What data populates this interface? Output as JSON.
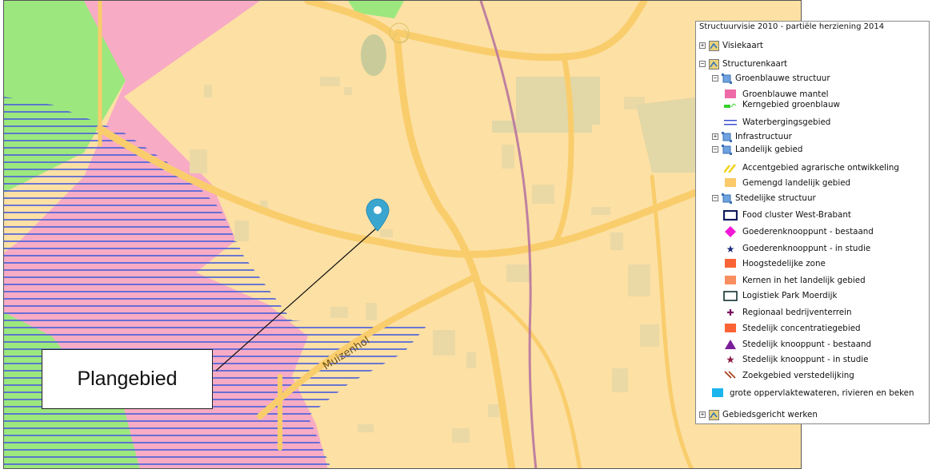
{
  "map": {
    "street_label": "Muizenhol",
    "plangebied_label": "Plangebied",
    "colors": {
      "background": "#fde0a4",
      "groenblauwe_mantel": "#f6a6c8",
      "kerngebied_groenblauw": "#9ce87e",
      "waterberging": "#4f63d8",
      "road": "#f9cd6c",
      "building": "#ebd9a5",
      "rail": "#b46fa0"
    }
  },
  "legend": {
    "title": "Structuurvisie 2010 - partiële herziening 2014",
    "items": [
      {
        "label": "Visiekaart",
        "level": 0,
        "toggle": "+",
        "icon": "layer-group-icon"
      },
      {
        "label": "Structurenkaart",
        "level": 0,
        "toggle": "−",
        "icon": "layer-group-icon"
      },
      {
        "label": "Groenblauwe structuur",
        "level": 1,
        "toggle": "−",
        "icon": "sublayer-icon"
      },
      {
        "label": "Groenblauwe mantel",
        "level": 2,
        "symbol": "pink-rect"
      },
      {
        "label": "Kerngebied groenblauw",
        "level": 2,
        "symbol": "green-line"
      },
      {
        "label": "Waterbergingsgebied",
        "level": 2,
        "symbol": "blue-double-line"
      },
      {
        "label": "Infrastructuur",
        "level": 1,
        "toggle": "+",
        "icon": "sublayer-icon"
      },
      {
        "label": "Landelijk gebied",
        "level": 1,
        "toggle": "−",
        "icon": "sublayer-icon"
      },
      {
        "label": "Accentgebied agrarische ontwikkeling",
        "level": 2,
        "symbol": "yellow-hatch"
      },
      {
        "label": "Gemengd landelijk gebied",
        "level": 2,
        "symbol": "orange-rect"
      },
      {
        "label": "Stedelijke structuur",
        "level": 1,
        "toggle": "−",
        "icon": "sublayer-icon"
      },
      {
        "label": "Food cluster West-Brabant",
        "level": 2,
        "symbol": "navy-outline-rect"
      },
      {
        "label": "Goederenknooppunt - bestaand",
        "level": 2,
        "symbol": "magenta-diamond"
      },
      {
        "label": "Goederenknooppunt - in studie",
        "level": 2,
        "symbol": "navy-star"
      },
      {
        "label": "Hoogstedelijke zone",
        "level": 2,
        "symbol": "red-orange-rect"
      },
      {
        "label": "Kernen in het landelijk gebied",
        "level": 2,
        "symbol": "salmon-rect"
      },
      {
        "label": "Logistiek Park Moerdijk",
        "level": 2,
        "symbol": "dark-outline-rect"
      },
      {
        "label": "Regionaal bedrijventerrein",
        "level": 2,
        "symbol": "purple-plus"
      },
      {
        "label": "Stedelijk concentratiegebied",
        "level": 2,
        "symbol": "red-orange-rect2"
      },
      {
        "label": "Stedelijk knooppunt - bestaand",
        "level": 2,
        "symbol": "purple-triangle"
      },
      {
        "label": "Stedelijk knooppunt - in studie",
        "level": 2,
        "symbol": "maroon-star"
      },
      {
        "label": "Zoekgebied verstedelijking",
        "level": 2,
        "symbol": "brown-hatch"
      },
      {
        "label": "grote oppervlaktewateren, rivieren en beken",
        "level": 3,
        "symbol": "cyan-rect"
      },
      {
        "label": "Gebiedsgericht werken",
        "level": 0,
        "toggle": "+",
        "icon": "layer-group-icon"
      }
    ]
  }
}
